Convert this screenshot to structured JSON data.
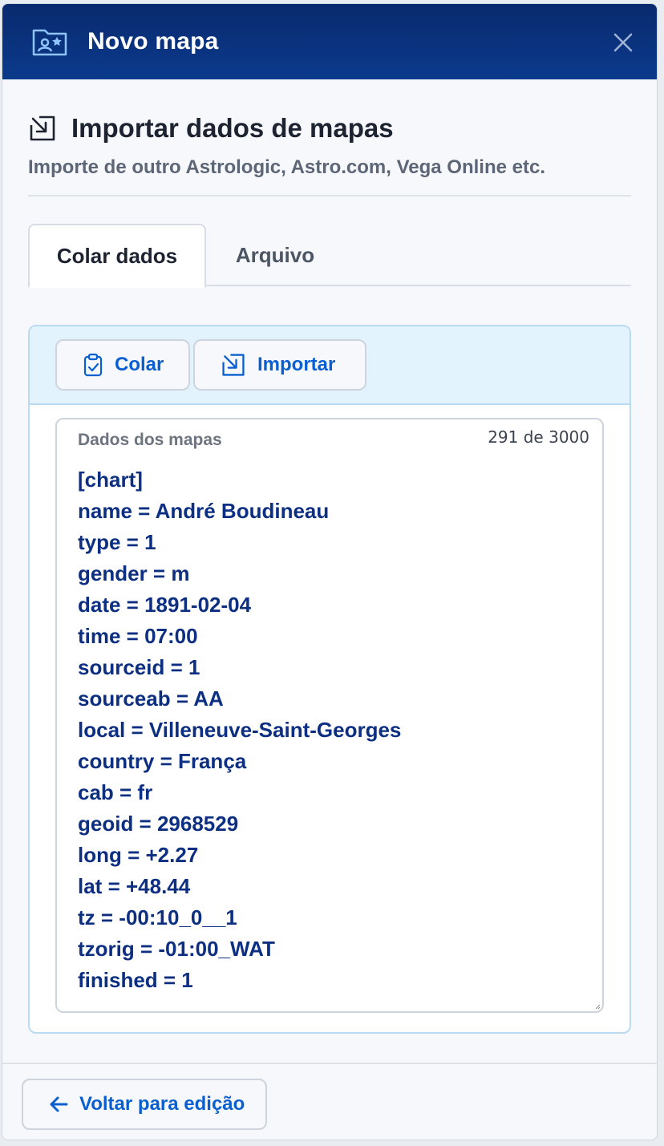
{
  "window": {
    "title": "Novo mapa"
  },
  "section": {
    "heading": "Importar dados de mapas",
    "subtitle": "Importe de outro Astrologic, Astro.com, Vega Online etc."
  },
  "tabs": [
    {
      "label": "Colar dados",
      "active": true
    },
    {
      "label": "Arquivo",
      "active": false
    }
  ],
  "toolbar": {
    "paste_label": "Colar",
    "import_label": "Importar"
  },
  "textarea": {
    "label": "Dados dos mapas",
    "counter": "291 de 3000",
    "lines": [
      "[chart]",
      "name = André Boudineau",
      "type = 1",
      "gender = m",
      "date = 1891-02-04",
      "time = 07:00",
      "sourceid = 1",
      "sourceab = AA",
      "local = Villeneuve-Saint-Georges",
      "country = França",
      "cab = fr",
      "geoid = 2968529",
      "long = +2.27",
      "lat = +48.44",
      "tz = -00:10_0__1",
      "tzorig = -01:00_WAT",
      "finished = 1"
    ]
  },
  "footer": {
    "back_label": "Voltar para edição"
  },
  "colors": {
    "titlebar": "#0b3a8c",
    "accent": "#0a5fd0",
    "text_dark": "#0d2f82"
  }
}
